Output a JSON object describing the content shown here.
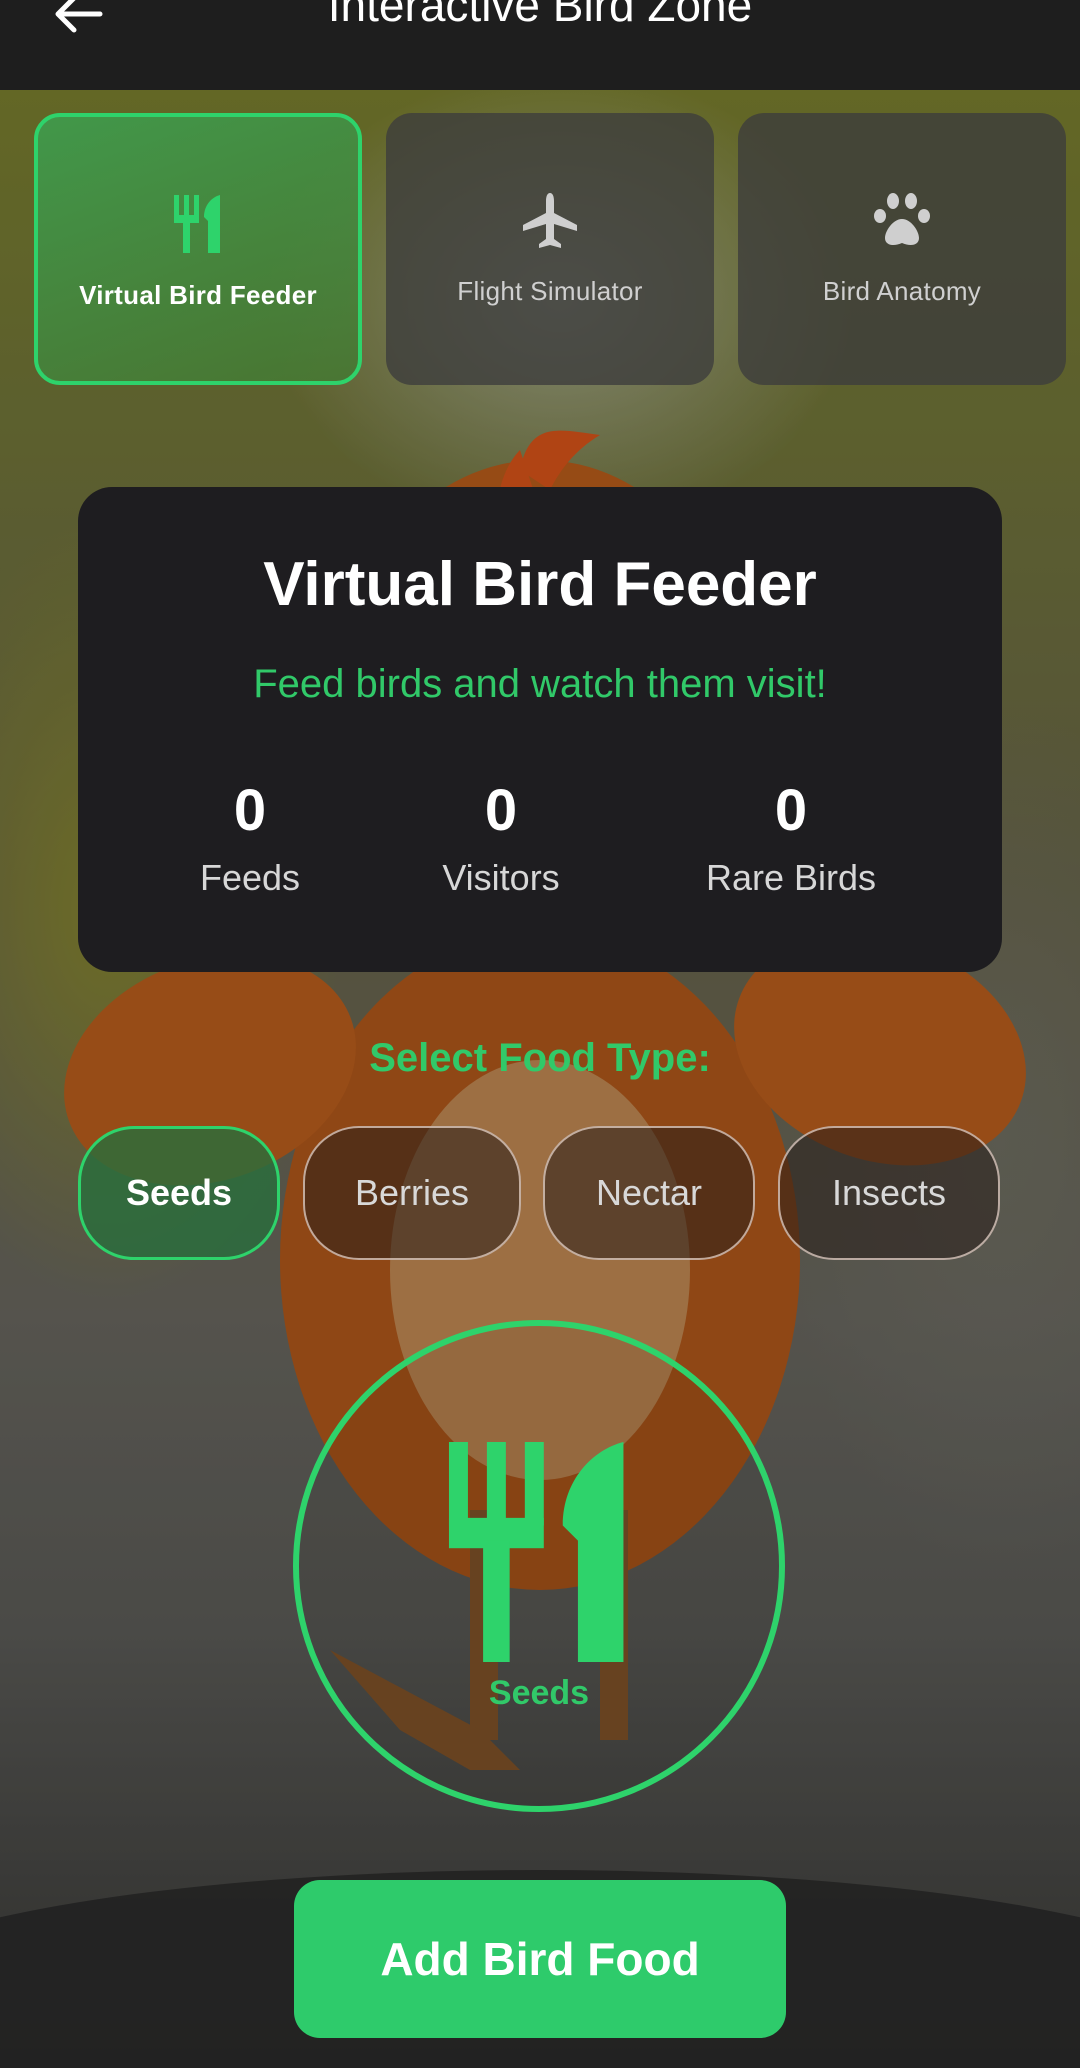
{
  "appbar": {
    "title": "Interactive Bird Zone"
  },
  "modes": [
    {
      "label": "Virtual Bird Feeder",
      "icon": "fork-knife-icon",
      "active": true
    },
    {
      "label": "Flight Simulator",
      "icon": "airplane-icon",
      "active": false
    },
    {
      "label": "Bird Anatomy",
      "icon": "paw-icon",
      "active": false
    }
  ],
  "feeder": {
    "title": "Virtual Bird Feeder",
    "subtitle": "Feed birds and watch them visit!",
    "stats": [
      {
        "value": "0",
        "label": "Feeds"
      },
      {
        "value": "0",
        "label": "Visitors"
      },
      {
        "value": "0",
        "label": "Rare Birds"
      }
    ]
  },
  "food": {
    "heading": "Select Food Type:",
    "options": [
      "Seeds",
      "Berries",
      "Nectar",
      "Insects"
    ],
    "selected": "Seeds",
    "selected_icon": "fork-knife-icon"
  },
  "action": {
    "label": "Add Bird Food"
  },
  "colors": {
    "accent": "#2ed36b",
    "accent_text": "#31c969",
    "card_bg": "#1e1d20",
    "appbar_bg": "#1e1e1e"
  }
}
